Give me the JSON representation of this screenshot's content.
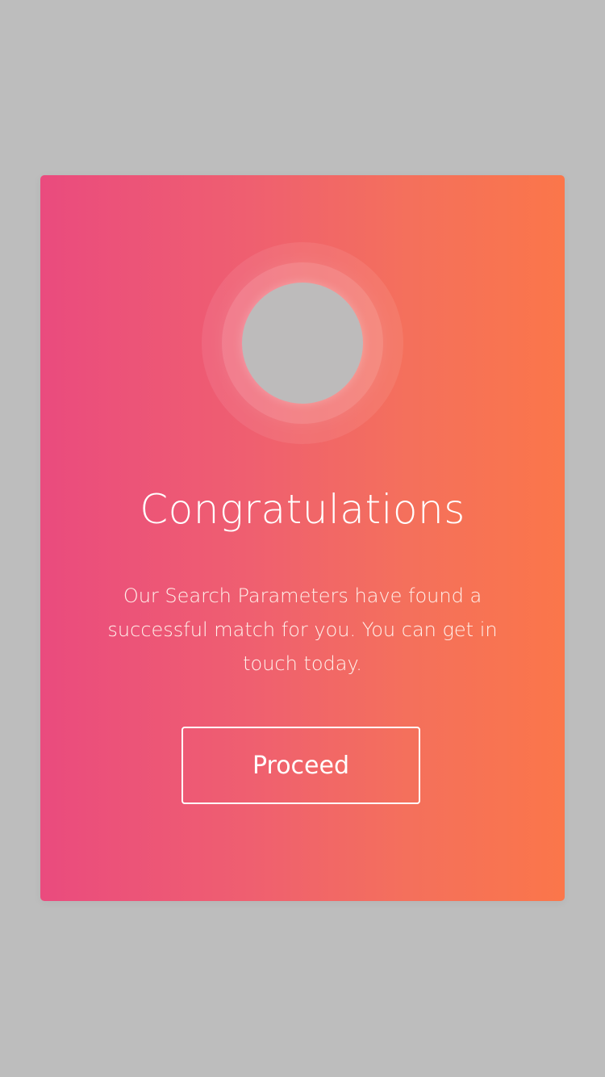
{
  "modal": {
    "title": "Congratulations",
    "message": "Our Search Parameters have found a successful match for you. You can get in touch today.",
    "button_label": "Proceed"
  },
  "colors": {
    "background": "#bdbdbd",
    "gradient_start": "#ea4b7e",
    "gradient_end": "#fb764a",
    "avatar_placeholder": "#bdbbbb",
    "text": "#ffffff"
  }
}
